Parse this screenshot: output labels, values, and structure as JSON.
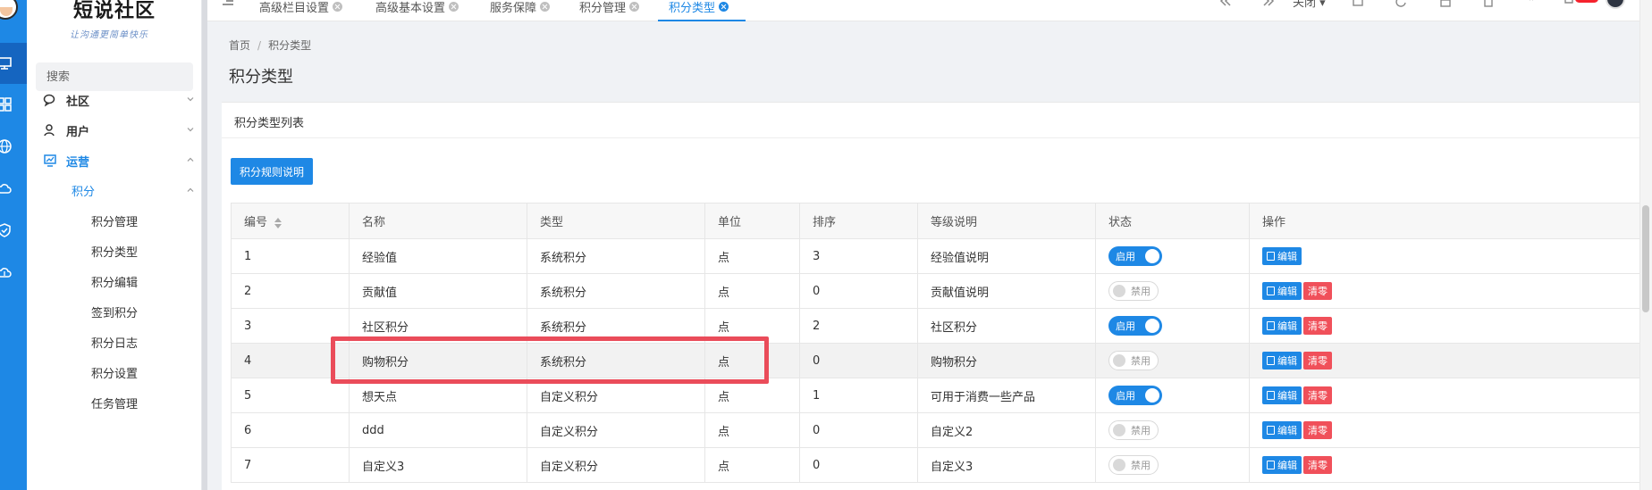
{
  "app": {
    "logo_title": "短说社区",
    "logo_subtitle": "让沟通更简单快乐",
    "accent_color": "#1e88e5",
    "danger_color": "#f0505a"
  },
  "rail_icons": [
    "monitor-icon",
    "grid-icon",
    "globe-icon",
    "cloud-icon",
    "shield-icon",
    "cloud-sync-icon"
  ],
  "sidebar": {
    "search_placeholder": "搜索",
    "menu": [
      {
        "label": "社区",
        "icon": "chat-icon"
      },
      {
        "label": "用户",
        "icon": "user-icon"
      },
      {
        "label": "运营",
        "icon": "chart-board-icon"
      }
    ],
    "submenu_label": "积分",
    "leaves": [
      "积分管理",
      "积分类型",
      "积分编辑",
      "签到积分",
      "积分日志",
      "积分设置",
      "任务管理"
    ]
  },
  "topbar": {
    "tabs": [
      {
        "label": "高级栏目设置"
      },
      {
        "label": "高级基本设置"
      },
      {
        "label": "服务保障"
      },
      {
        "label": "积分管理"
      },
      {
        "label": "积分类型"
      }
    ],
    "close_label": "关闭"
  },
  "breadcrumb": {
    "home": "首页",
    "sep": "/",
    "current": "积分类型"
  },
  "page_title": "积分类型",
  "panel": {
    "title": "积分类型列表",
    "rule_button": "积分规则说明"
  },
  "table": {
    "headers": [
      "编号",
      "名称",
      "类型",
      "单位",
      "排序",
      "等级说明",
      "状态",
      "操作"
    ],
    "rows": [
      {
        "id": "1",
        "name": "经验值",
        "type": "系统积分",
        "unit": "点",
        "sort": "3",
        "desc": "经验值说明",
        "status": "启用",
        "clear": false
      },
      {
        "id": "2",
        "name": "贡献值",
        "type": "系统积分",
        "unit": "点",
        "sort": "0",
        "desc": "贡献值说明",
        "status": "禁用",
        "clear": true
      },
      {
        "id": "3",
        "name": "社区积分",
        "type": "系统积分",
        "unit": "点",
        "sort": "2",
        "desc": "社区积分",
        "status": "启用",
        "clear": true
      },
      {
        "id": "4",
        "name": "购物积分",
        "type": "系统积分",
        "unit": "点",
        "sort": "0",
        "desc": "购物积分",
        "status": "禁用",
        "clear": true
      },
      {
        "id": "5",
        "name": "想天点",
        "type": "自定义积分",
        "unit": "点",
        "sort": "1",
        "desc": "可用于消费一些产品",
        "status": "启用",
        "clear": true
      },
      {
        "id": "6",
        "name": "ddd",
        "type": "自定义积分",
        "unit": "点",
        "sort": "0",
        "desc": "自定义2",
        "status": "禁用",
        "clear": true
      },
      {
        "id": "7",
        "name": "自定义3",
        "type": "自定义积分",
        "unit": "点",
        "sort": "0",
        "desc": "自定义3",
        "status": "禁用",
        "clear": true
      }
    ],
    "edit_label": "编辑",
    "clear_label": "清零"
  }
}
